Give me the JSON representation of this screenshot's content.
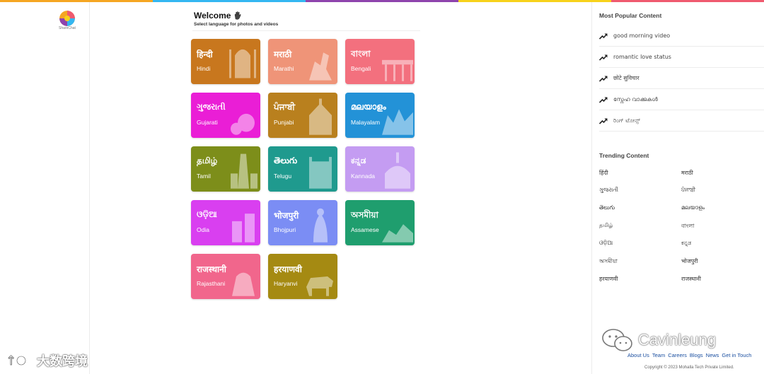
{
  "topbar_colors": [
    "#f5a623",
    "#34b7f1",
    "#8e44ad",
    "#f7d21b",
    "#ef5a6f"
  ],
  "sidebar": {
    "logo_text": "ShareChat"
  },
  "welcome": {
    "title": "Welcome",
    "subtitle": "Select language for photos and videos"
  },
  "languages": [
    {
      "native": "हिन्दी",
      "latin": "Hindi",
      "color": "#c8771e"
    },
    {
      "native": "मराठी",
      "latin": "Marathi",
      "color": "#ef9478"
    },
    {
      "native": "বাংলা",
      "latin": "Bengali",
      "color": "#f3707e"
    },
    {
      "native": "ગુજરાતી",
      "latin": "Gujarati",
      "color": "#ea1ed6"
    },
    {
      "native": "ਪੰਜਾਬੀ",
      "latin": "Punjabi",
      "color": "#b9801e"
    },
    {
      "native": "മലയാളം",
      "latin": "Malayalam",
      "color": "#2392d7"
    },
    {
      "native": "தமிழ்",
      "latin": "Tamil",
      "color": "#7d8e1a"
    },
    {
      "native": "తెలుగు",
      "latin": "Telugu",
      "color": "#1f9a8e"
    },
    {
      "native": "ಕನ್ನಡ",
      "latin": "Kannada",
      "color": "#c49cf2"
    },
    {
      "native": "ଓଡ଼ିଆ",
      "latin": "Odia",
      "color": "#d93ff0"
    },
    {
      "native": "भोजपुरी",
      "latin": "Bhojpuri",
      "color": "#7b8df4"
    },
    {
      "native": "অসমীয়া",
      "latin": "Assamese",
      "color": "#1f9e6e"
    },
    {
      "native": "राजस्थानी",
      "latin": "Rajasthani",
      "color": "#f1668c"
    },
    {
      "native": "हरयाणवी",
      "latin": "Haryanvi",
      "color": "#a58a12"
    }
  ],
  "popular": {
    "heading": "Most Popular Content",
    "items": [
      "good morning video",
      "romantic love status",
      "छोटे सुविचार",
      "സ്നേഹ വാക്കുകള്‍",
      "ರಿಂಗ್ ಟೋನ್ಸ್"
    ]
  },
  "trending": {
    "heading": "Trending Content",
    "items": [
      "हिंदी",
      "मराठी",
      "ગુજરાતી",
      "ਪੰਜਾਬੀ",
      "తెలుగు",
      "മലയാളം",
      "தமிழ்",
      "বাংলা",
      "ଓଡ଼ିଆ",
      "ಕನ್ನಡ",
      "অসমীয়া",
      "भोजपुरी",
      "हरयाणवी",
      "राजस्थानी"
    ]
  },
  "footer": {
    "links": [
      "About Us",
      "Team",
      "Careers",
      "Blogs",
      "News",
      "Get in Touch"
    ],
    "copyright": "Copyright © 2023 Mohalla Tech Private Limited."
  },
  "watermarks": {
    "right": "Cavinleung",
    "left": "大数跨境"
  }
}
